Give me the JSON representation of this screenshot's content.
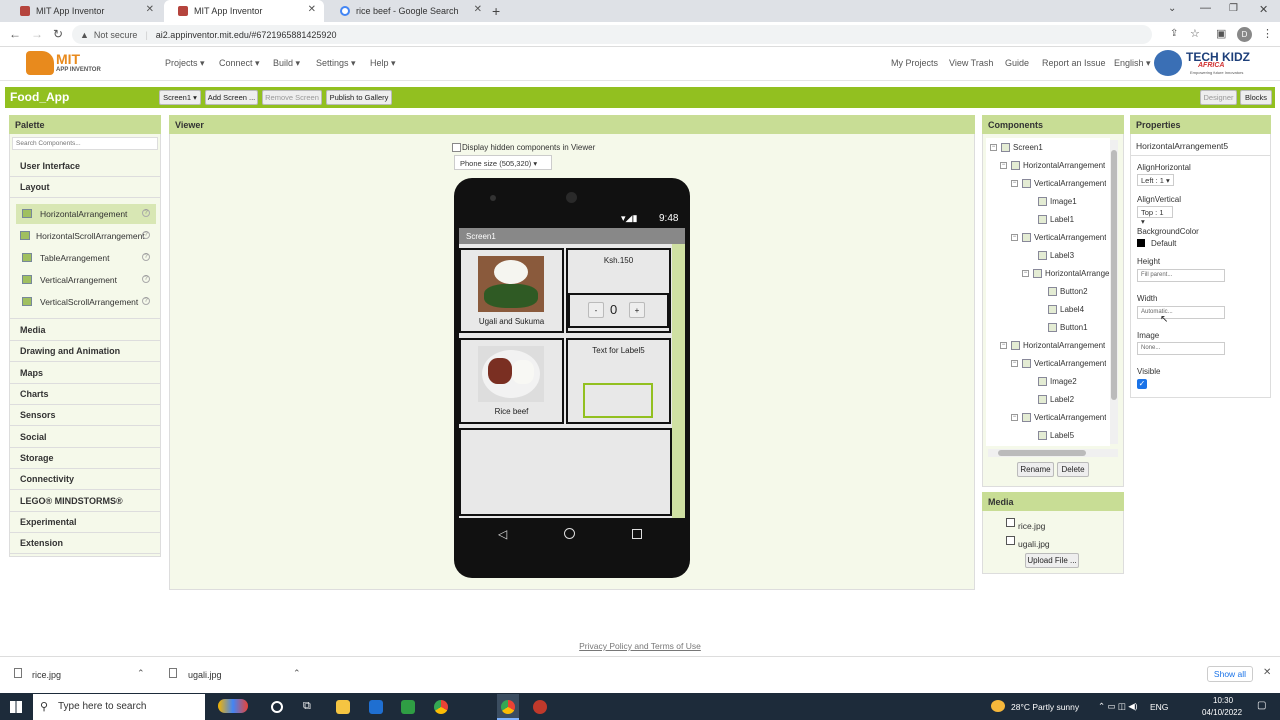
{
  "browser": {
    "tabs": [
      {
        "title": "MIT App Inventor",
        "active": false
      },
      {
        "title": "MIT App Inventor",
        "active": true
      },
      {
        "title": "rice beef - Google Search",
        "active": false
      }
    ],
    "security_label": "Not secure",
    "url": "ai2.appinventor.mit.edu/#6721965881425920",
    "profile_initial": "D"
  },
  "header": {
    "logo_line1": "MIT",
    "logo_line2": "APP INVENTOR",
    "menus": [
      "Projects ▾",
      "Connect ▾",
      "Build ▾",
      "Settings ▾",
      "Help ▾"
    ],
    "right_links": [
      "My Projects",
      "View Trash",
      "Guide",
      "Report an Issue",
      "English ▾"
    ],
    "brand_line1": "TECH KIDZ",
    "brand_line2": "AFRICA",
    "brand_tagline": "Empowering future Innovators"
  },
  "toolbar": {
    "app_name": "Food_App",
    "screen_select": "Screen1 ▾",
    "add_screen": "Add Screen ...",
    "remove_screen": "Remove Screen",
    "publish": "Publish to Gallery",
    "designer": "Designer",
    "blocks": "Blocks"
  },
  "palette": {
    "title": "Palette",
    "search_placeholder": "Search Components...",
    "cat_ui": "User Interface",
    "cat_layout": "Layout",
    "items": [
      "HorizontalArrangement",
      "HorizontalScrollArrangement",
      "TableArrangement",
      "VerticalArrangement",
      "VerticalScrollArrangement"
    ],
    "categories": [
      "Media",
      "Drawing and Animation",
      "Maps",
      "Charts",
      "Sensors",
      "Social",
      "Storage",
      "Connectivity",
      "LEGO® MINDSTORMS®",
      "Experimental",
      "Extension"
    ]
  },
  "viewer": {
    "title": "Viewer",
    "hidden_label": "Display hidden components in Viewer",
    "phone_size": "Phone size (505,320) ▾",
    "time": "9:48",
    "screen_title": "Screen1",
    "food1_label": "Ugali and Sukuma",
    "price_label": "Ksh.150",
    "minus": "-",
    "count": "0",
    "plus": "+",
    "food2_label": "Rice beef",
    "label5": "Text for Label5"
  },
  "components": {
    "title": "Components",
    "tree": [
      {
        "label": "Screen1",
        "depth": 0
      },
      {
        "label": "HorizontalArrangement",
        "depth": 1
      },
      {
        "label": "VerticalArrangement",
        "depth": 2
      },
      {
        "label": "Image1",
        "depth": 3
      },
      {
        "label": "Label1",
        "depth": 3
      },
      {
        "label": "VerticalArrangement",
        "depth": 2
      },
      {
        "label": "Label3",
        "depth": 3
      },
      {
        "label": "HorizontalArrangement",
        "depth": 3
      },
      {
        "label": "Button2",
        "depth": 4
      },
      {
        "label": "Label4",
        "depth": 4
      },
      {
        "label": "Button1",
        "depth": 4
      },
      {
        "label": "HorizontalArrangement",
        "depth": 1
      },
      {
        "label": "VerticalArrangement",
        "depth": 2
      },
      {
        "label": "Image2",
        "depth": 3
      },
      {
        "label": "Label2",
        "depth": 3
      },
      {
        "label": "VerticalArrangement",
        "depth": 2
      },
      {
        "label": "Label5",
        "depth": 3
      }
    ],
    "rename": "Rename",
    "delete": "Delete"
  },
  "media": {
    "title": "Media",
    "files": [
      "rice.jpg",
      "ugali.jpg"
    ],
    "upload": "Upload File ..."
  },
  "properties": {
    "title": "Properties",
    "component": "HorizontalArrangement5",
    "align_h_label": "AlignHorizontal",
    "align_h_value": "Left : 1 ▾",
    "align_v_label": "AlignVertical",
    "align_v_value": "Top : 1 ▾",
    "bg_label": "BackgroundColor",
    "bg_value": "Default",
    "height_label": "Height",
    "height_value": "Fill parent...",
    "width_label": "Width",
    "width_value": "Automatic...",
    "image_label": "Image",
    "image_value": "None...",
    "visible_label": "Visible",
    "visible_checked": true
  },
  "footer": {
    "privacy": "Privacy Policy and Terms of Use"
  },
  "downloads": {
    "files": [
      "rice.jpg",
      "ugali.jpg"
    ],
    "show_all": "Show all"
  },
  "taskbar": {
    "search_placeholder": "Type here to search",
    "weather": "28°C  Partly sunny",
    "lang": "ENG",
    "time": "10:30",
    "date": "04/10/2022"
  },
  "colors": {
    "accent_green": "#92c020",
    "panel_header": "#c8dd95",
    "taskbar": "#1d2b3a"
  }
}
